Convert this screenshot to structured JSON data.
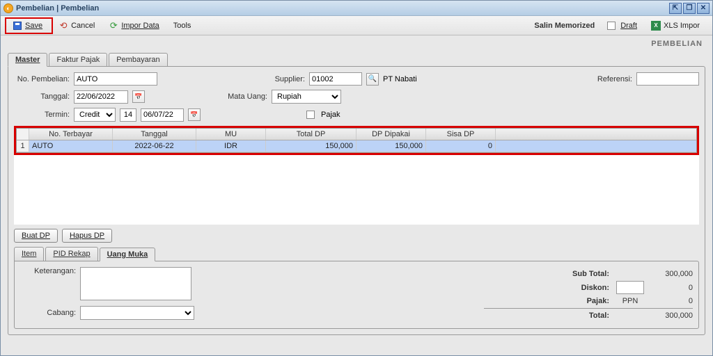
{
  "window": {
    "title": "Pembelian | Pembelian",
    "heading": "PEMBELIAN"
  },
  "toolbar": {
    "save": "Save",
    "cancel": "Cancel",
    "import": "Impor Data",
    "tools": "Tools",
    "salin": "Salin Memorized",
    "draft": "Draft",
    "xls": "XLS Impor"
  },
  "tabs": {
    "master": "Master",
    "faktur": "Faktur Pajak",
    "bayar": "Pembayaran"
  },
  "fields": {
    "no_label": "No. Pembelian:",
    "no_value": "AUTO",
    "tanggal_label": "Tanggal:",
    "tanggal_value": "22/06/2022",
    "termin_label": "Termin:",
    "termin_type": "Credit",
    "termin_days": "14",
    "termin_due": "06/07/22",
    "supplier_label": "Supplier:",
    "supplier_code": "01002",
    "supplier_name": "PT Nabati",
    "matauang_label": "Mata Uang:",
    "matauang_value": "Rupiah",
    "pajak_label": "Pajak",
    "referensi_label": "Referensi:",
    "referensi_value": ""
  },
  "grid": {
    "headers": {
      "no": "No. Terbayar",
      "tgl": "Tanggal",
      "mu": "MU",
      "total": "Total DP",
      "dipakai": "DP Dipakai",
      "sisa": "Sisa DP"
    },
    "row": {
      "idx": "1",
      "no": "AUTO",
      "tgl": "2022-06-22",
      "mu": "IDR",
      "total": "150,000",
      "dipakai": "150,000",
      "sisa": "0"
    }
  },
  "buttons": {
    "buat": "Buat DP",
    "hapus": "Hapus DP"
  },
  "subtabs": {
    "item": "Item",
    "pid": "PID Rekap",
    "uang": "Uang Muka"
  },
  "lower": {
    "ket_label": "Keterangan:",
    "cabang_label": "Cabang:"
  },
  "summary": {
    "subtotal_label": "Sub Total:",
    "subtotal_value": "300,000",
    "diskon_label": "Diskon:",
    "diskon_pct": "",
    "diskon_value": "0",
    "pajak_label": "Pajak:",
    "pajak_type": "PPN",
    "pajak_value": "0",
    "total_label": "Total:",
    "total_value": "300,000"
  }
}
